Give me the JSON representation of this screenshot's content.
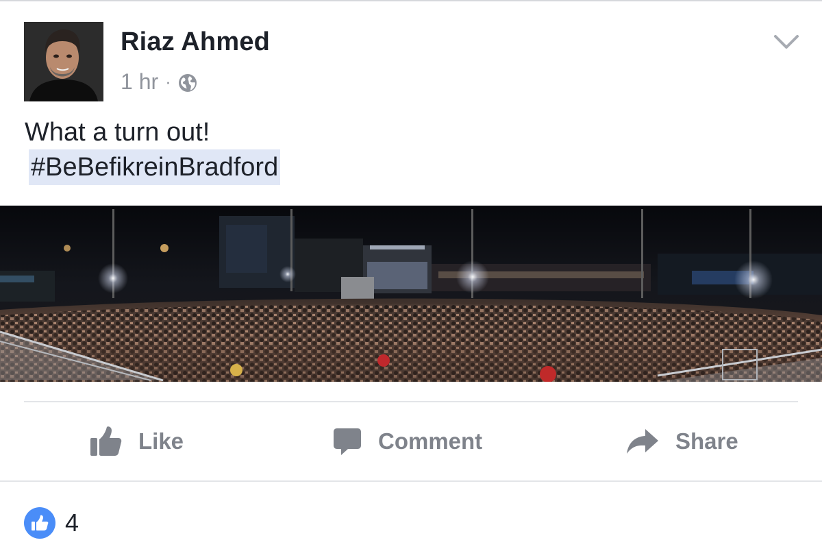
{
  "post": {
    "author": "Riaz Ahmed",
    "time": "1 hr",
    "separator": "·",
    "privacy_icon": "globe-icon",
    "menu_icon": "chevron-down-icon",
    "text": "What a turn out!",
    "hashtag": "#BeBefikreinBradford",
    "hashtag_highlight": "#e0e7f6"
  },
  "actions": {
    "like": "Like",
    "comment": "Comment",
    "share": "Share",
    "icons": [
      "thumbs-up-icon",
      "comment-bubble-icon",
      "share-arrow-icon"
    ]
  },
  "reactions": {
    "like_count": "4",
    "icon": "like-badge-icon",
    "color": "#4a8df8"
  },
  "colors": {
    "text": "#1d2129",
    "muted": "#90949c",
    "action_text": "#7f838b"
  }
}
